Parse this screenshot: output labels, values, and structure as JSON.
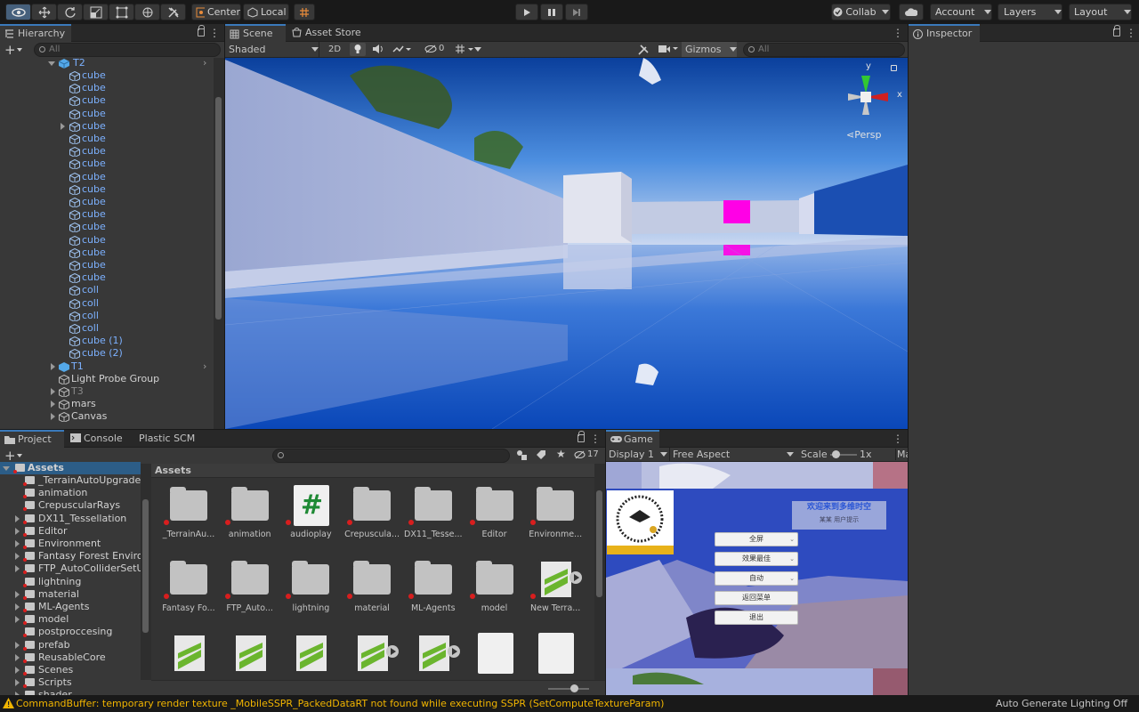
{
  "toolbar": {
    "center_label": "Center",
    "local_label": "Local",
    "collab_label": "Collab",
    "account_label": "Account",
    "layers_label": "Layers",
    "layout_label": "Layout"
  },
  "hierarchy": {
    "tab": "Hierarchy",
    "search_placeholder": "All",
    "root_label": "T2",
    "children": [
      "cube",
      "cube",
      "cube",
      "cube",
      "cube",
      "cube",
      "cube",
      "cube",
      "cube",
      "cube",
      "cube",
      "cube",
      "cube",
      "cube",
      "cube",
      "cube",
      "cube",
      "coll",
      "coll",
      "coll",
      "coll",
      "cube (1)",
      "cube (2)"
    ],
    "after": [
      {
        "label": "T1"
      },
      {
        "label": "Light Probe Group"
      },
      {
        "label": "T3"
      },
      {
        "label": "mars"
      },
      {
        "label": "Canvas"
      }
    ]
  },
  "scene": {
    "tab": "Scene",
    "asset_store_tab": "Asset Store",
    "shading": "Shaded",
    "mode_2d": "2D",
    "hidden_count": "0",
    "gizmos": "Gizmos",
    "search_placeholder": "All",
    "persp": "Persp",
    "axis_x": "x",
    "axis_y": "y",
    "accent_colors": {
      "sky_top": "#0a3f9c",
      "magenta": "#ff00e6"
    }
  },
  "inspector": {
    "tab": "Inspector"
  },
  "project": {
    "tabs": [
      "Project",
      "Console",
      "Plastic SCM"
    ],
    "search_placeholder": "",
    "count": "17",
    "assets_root": "Assets",
    "breadcrumb": "Assets",
    "tree": [
      "_TerrainAutoUpgrade",
      "animation",
      "CrepuscularRays",
      "DX11_Tessellation",
      "Editor",
      "Environment",
      "Fantasy Forest Environ",
      "FTP_AutoColliderSetUp",
      "lightning",
      "material",
      "ML-Agents",
      "model",
      "postproccesing",
      "prefab",
      "ReusableCore",
      "Scenes",
      "Scripts",
      "shader"
    ],
    "grid": [
      {
        "name": "_TerrainAu..."
      },
      {
        "name": "animation"
      },
      {
        "name": "audioplay"
      },
      {
        "name": "Crepuscula..."
      },
      {
        "name": "DX11_Tesse..."
      },
      {
        "name": "Editor"
      },
      {
        "name": "Environme..."
      },
      {
        "name": "Fantasy Fo..."
      },
      {
        "name": "FTP_Auto..."
      },
      {
        "name": "lightning"
      },
      {
        "name": "material"
      },
      {
        "name": "ML-Agents"
      },
      {
        "name": "model"
      },
      {
        "name": "New Terra..."
      }
    ]
  },
  "game": {
    "tab": "Game",
    "display": "Display 1",
    "aspect": "Free Aspect",
    "scale_label": "Scale",
    "scale_value": "1x",
    "maximize_label": "Ma",
    "menu": [
      "全屏",
      "效果最佳",
      "自动",
      "返回菜单",
      "退出"
    ],
    "title_banner": "欢迎来到多维时空",
    "subtitle": "某某 用户提示"
  },
  "status": {
    "message": "CommandBuffer: temporary render texture _MobileSSPR_PackedDataRT not found while executing SSPR (SetComputeTextureParam)",
    "right": "Auto Generate Lighting Off"
  }
}
